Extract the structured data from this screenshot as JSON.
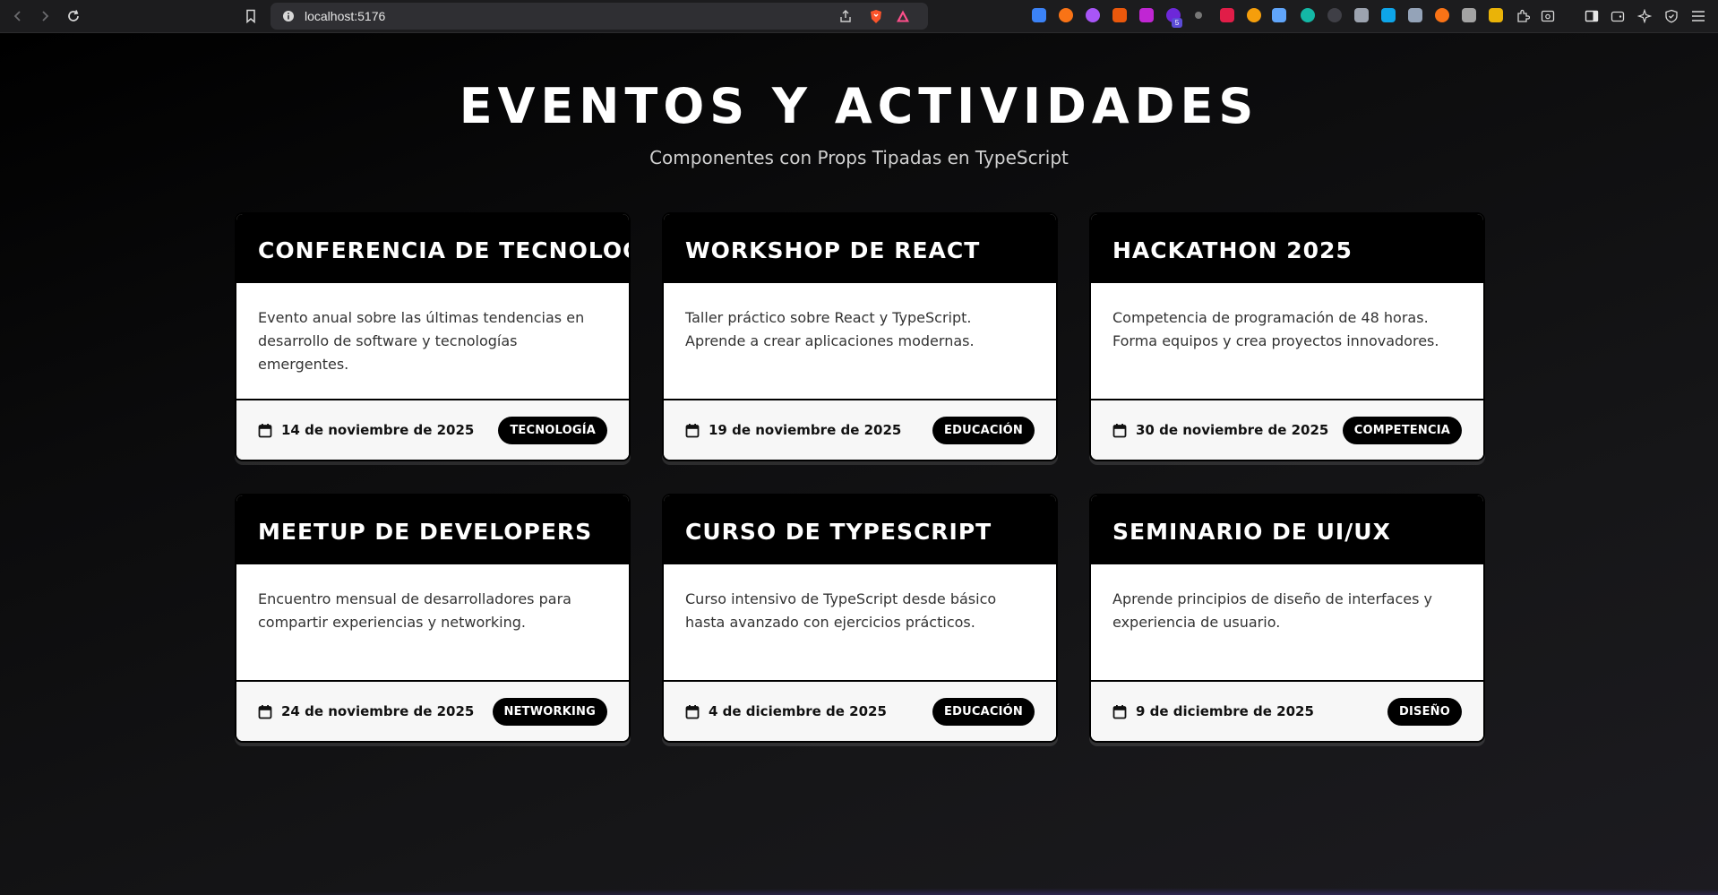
{
  "browser": {
    "url": "localhost:5176",
    "extension_badge": "5",
    "colors": {
      "toolbar": "#1c1c1e",
      "urlbar": "#2f2f33",
      "brave": "#fb542b"
    }
  },
  "page": {
    "title": "EVENTOS Y ACTIVIDADES",
    "subtitle": "Componentes con Props Tipadas en TypeScript"
  },
  "events": [
    {
      "title": "CONFERENCIA DE TECNOLOGÍA",
      "description": "Evento anual sobre las últimas tendencias en desarrollo de software y tecnologías emergentes.",
      "date": "14 de noviembre de 2025",
      "category": "TECNOLOGÍA"
    },
    {
      "title": "WORKSHOP DE REACT",
      "description": "Taller práctico sobre React y TypeScript. Aprende a crear aplicaciones modernas.",
      "date": "19 de noviembre de 2025",
      "category": "EDUCACIÓN"
    },
    {
      "title": "HACKATHON 2025",
      "description": "Competencia de programación de 48 horas. Forma equipos y crea proyectos innovadores.",
      "date": "30 de noviembre de 2025",
      "category": "COMPETENCIA"
    },
    {
      "title": "MEETUP DE DEVELOPERS",
      "description": "Encuentro mensual de desarrolladores para compartir experiencias y networking.",
      "date": "24 de noviembre de 2025",
      "category": "NETWORKING"
    },
    {
      "title": "CURSO DE TYPESCRIPT",
      "description": "Curso intensivo de TypeScript desde básico hasta avanzado con ejercicios prácticos.",
      "date": "4 de diciembre de 2025",
      "category": "EDUCACIÓN"
    },
    {
      "title": "SEMINARIO DE UI/UX",
      "description": "Aprende principios de diseño de interfaces y experiencia de usuario.",
      "date": "9 de diciembre de 2025",
      "category": "DISEÑO"
    }
  ]
}
